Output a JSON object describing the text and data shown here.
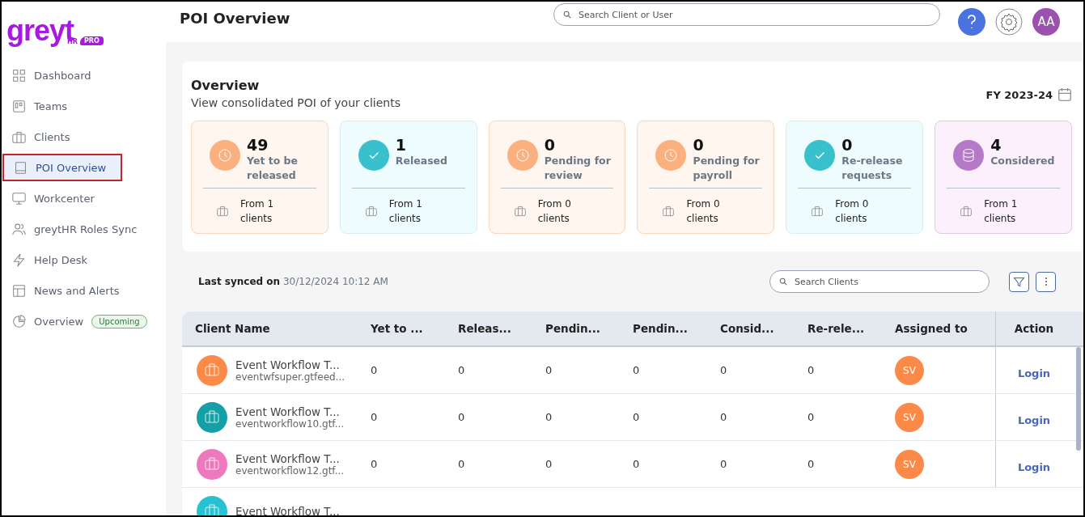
{
  "sidebar": {
    "logo": {
      "word": "greyt",
      "hr": "HR",
      "badge": "PRO"
    },
    "items": [
      {
        "label": "Dashboard",
        "selected": false
      },
      {
        "label": "Teams",
        "selected": false
      },
      {
        "label": "Clients",
        "selected": false
      },
      {
        "label": "POI Overview",
        "selected": true
      },
      {
        "label": "Workcenter",
        "selected": false
      },
      {
        "label": "greytHR Roles Sync",
        "selected": false
      },
      {
        "label": "Help Desk",
        "selected": false
      },
      {
        "label": "News and Alerts",
        "selected": false
      },
      {
        "label": "Overview",
        "selected": false,
        "badge": "Upcoming"
      }
    ]
  },
  "header": {
    "title": "POI Overview",
    "search": {
      "placeholder": "Search Client or User"
    },
    "avatar": "AA"
  },
  "overview": {
    "title": "Overview",
    "subtitle": "View consolidated POI of your clients",
    "fy": "FY 2023-24",
    "cards": [
      {
        "kind": "pending",
        "count": "49",
        "label": "Yet to be released",
        "footer": "From 1 clients"
      },
      {
        "kind": "done",
        "count": "1",
        "label": "Released",
        "footer": "From 1 clients"
      },
      {
        "kind": "pending",
        "count": "0",
        "label": "Pending for review",
        "footer": "From 0 clients"
      },
      {
        "kind": "pending",
        "count": "0",
        "label": "Pending for payroll",
        "footer": "From 0 clients"
      },
      {
        "kind": "done",
        "count": "0",
        "label": "Re-release requests",
        "footer": "From 0 clients"
      },
      {
        "kind": "considered",
        "count": "4",
        "label": "Considered",
        "footer": "From 1 clients"
      }
    ]
  },
  "sync": {
    "label": "Last synced on",
    "value": "30/12/2024 10:12 AM"
  },
  "client_search": {
    "placeholder": "Search Clients"
  },
  "table": {
    "columns": [
      "Client Name",
      "Yet to ...",
      "Releas...",
      "Pendin...",
      "Pendin...",
      "Consid...",
      "Re-rele...",
      "Assigned to",
      "Action"
    ],
    "rows": [
      {
        "name": "Event Workflow T...",
        "domain": "eventwfsuper.gtfeed...",
        "color": "#fb8a48",
        "values": [
          "0",
          "0",
          "0",
          "0",
          "0",
          "0"
        ],
        "assignee": "SV",
        "action": "Login"
      },
      {
        "name": "Event Workflow T...",
        "domain": "eventworkflow10.gtf...",
        "color": "#14a0a6",
        "values": [
          "0",
          "0",
          "0",
          "0",
          "0",
          "0"
        ],
        "assignee": "SV",
        "action": "Login"
      },
      {
        "name": "Event Workflow T...",
        "domain": "eventworkflow12.gtf...",
        "color": "#ee78bd",
        "values": [
          "0",
          "0",
          "0",
          "0",
          "0",
          "0"
        ],
        "assignee": "SV",
        "action": "Login"
      },
      {
        "name": "Event Workflow T...",
        "color": "#27c2d2"
      }
    ]
  }
}
